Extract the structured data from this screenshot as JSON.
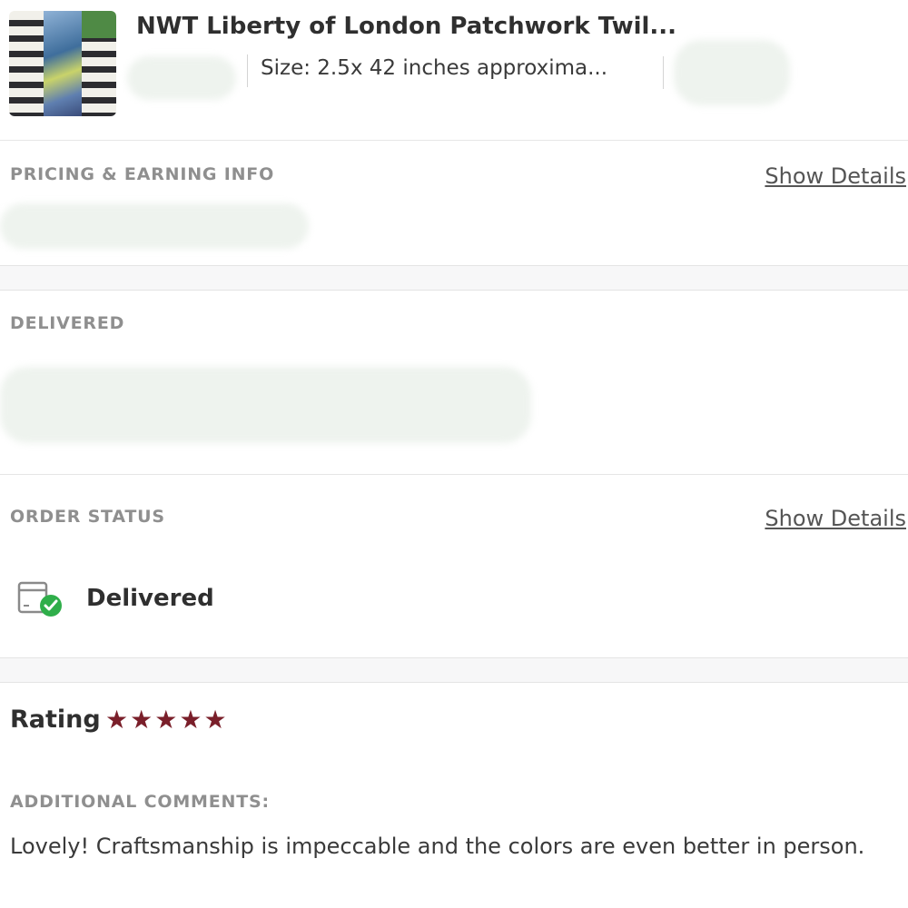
{
  "listing": {
    "title": "NWT Liberty of London Patchwork Twil...",
    "subtitle": "Size: 2.5x 42 inches approxima..."
  },
  "sections": {
    "pricing": {
      "label": "PRICING & EARNING INFO",
      "link": "Show Details"
    },
    "delivered": {
      "label": "DELIVERED"
    },
    "order_status": {
      "label": "ORDER STATUS",
      "link": "Show Details",
      "status": "Delivered"
    }
  },
  "rating": {
    "label": "Rating",
    "stars": 5,
    "star_color": "#7a1f2a"
  },
  "comments": {
    "label": "ADDITIONAL COMMENTS:",
    "text": "Lovely! Craftsmanship is impeccable and the colors are even better in person."
  },
  "colors": {
    "accent_check": "#2fae4a",
    "section_label": "#8f8f8f"
  }
}
